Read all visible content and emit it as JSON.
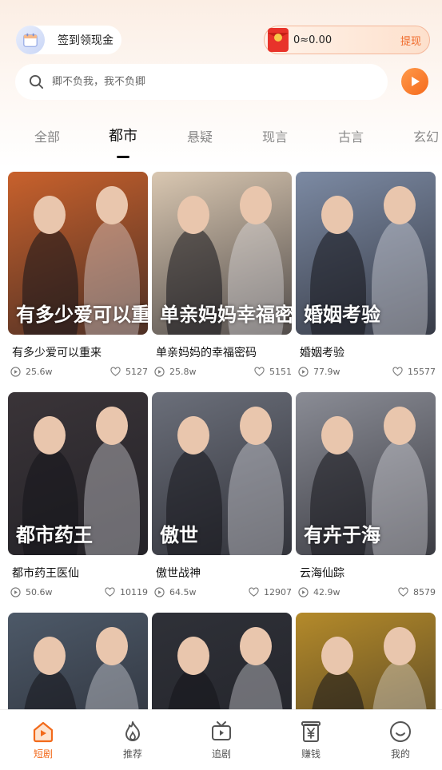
{
  "header": {
    "checkin_label": "签到领现金",
    "balance": "0≈0.00",
    "withdraw_label": "提现"
  },
  "search": {
    "placeholder": "卿不负我，我不负卿"
  },
  "tabs": [
    {
      "label": "全部",
      "active": false
    },
    {
      "label": "都市",
      "active": true
    },
    {
      "label": "悬疑",
      "active": false
    },
    {
      "label": "现言",
      "active": false
    },
    {
      "label": "古言",
      "active": false
    },
    {
      "label": "玄幻",
      "active": false
    }
  ],
  "dramas": [
    {
      "title": "有多少爱可以重来",
      "poster_text": "有多少爱可以重来",
      "plays": "25.6w",
      "likes": "5127",
      "bg": "#c8612c"
    },
    {
      "title": "单亲妈妈的幸福密码",
      "poster_text": "单亲妈妈幸福密码",
      "plays": "25.8w",
      "likes": "5151",
      "bg": "#d9c7b1"
    },
    {
      "title": "婚姻考验",
      "poster_text": "婚姻考验",
      "plays": "77.9w",
      "likes": "15577",
      "bg": "#7c8aa3"
    },
    {
      "title": "都市药王医仙",
      "poster_text": "都市药王",
      "plays": "50.6w",
      "likes": "10119",
      "bg": "#3a3438"
    },
    {
      "title": "傲世战神",
      "poster_text": "傲世",
      "plays": "64.5w",
      "likes": "12907",
      "bg": "#6b6f7a"
    },
    {
      "title": "云海仙踪",
      "poster_text": "有卉于海",
      "plays": "42.9w",
      "likes": "8579",
      "bg": "#8a8c95"
    },
    {
      "title": "",
      "poster_text": "",
      "plays": "",
      "likes": "",
      "bg": "#4d5968"
    },
    {
      "title": "",
      "poster_text": "",
      "plays": "",
      "likes": "",
      "bg": "#2f3138"
    },
    {
      "title": "",
      "poster_text": "",
      "plays": "",
      "likes": "",
      "bg": "#b48a2a"
    }
  ],
  "bottom_nav": [
    {
      "label": "短剧",
      "icon": "home-icon",
      "active": true
    },
    {
      "label": "推荐",
      "icon": "flame-icon",
      "active": false
    },
    {
      "label": "追剧",
      "icon": "tv-icon",
      "active": false
    },
    {
      "label": "赚钱",
      "icon": "yen-icon",
      "active": false
    },
    {
      "label": "我的",
      "icon": "profile-icon",
      "active": false
    }
  ],
  "colors": {
    "accent": "#f26a1b",
    "active_text": "#111111",
    "inactive_text": "#888888"
  }
}
